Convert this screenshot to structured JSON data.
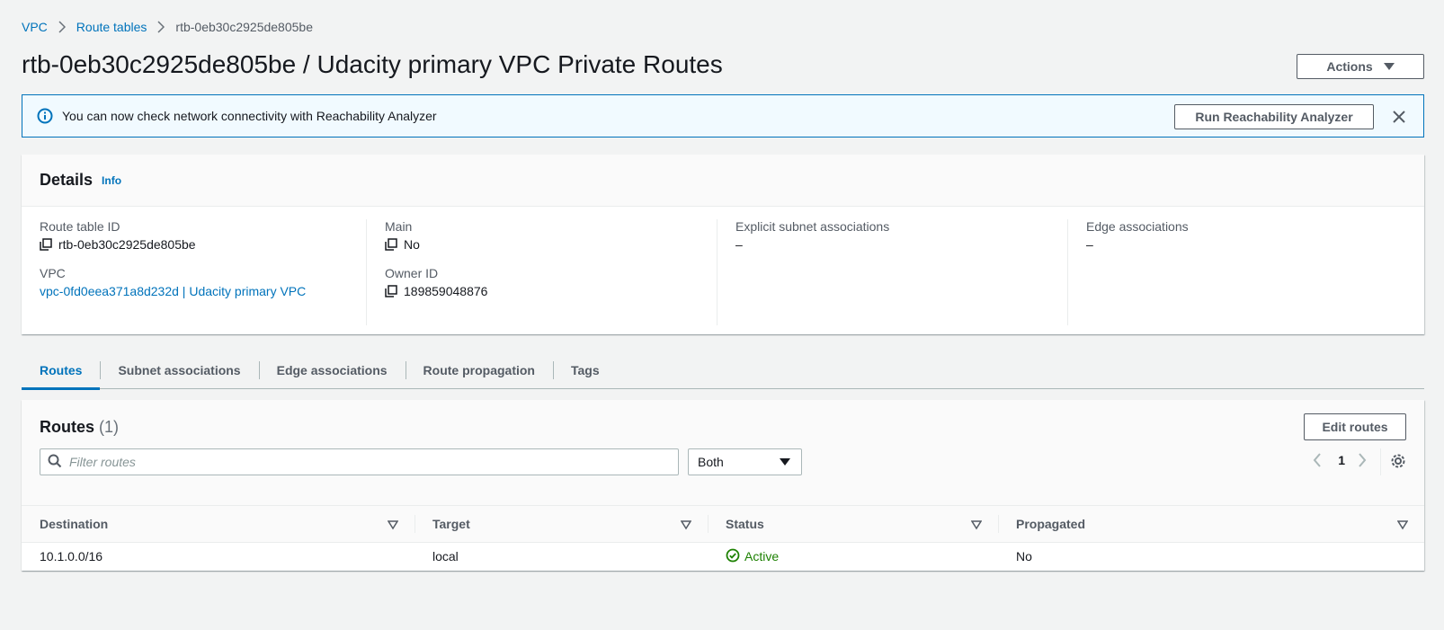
{
  "breadcrumb": {
    "items": [
      "VPC",
      "Route tables"
    ],
    "current": "rtb-0eb30c2925de805be"
  },
  "header": {
    "title": "rtb-0eb30c2925de805be / Udacity primary VPC Private Routes",
    "actions_label": "Actions"
  },
  "flash": {
    "message": "You can now check network connectivity with Reachability Analyzer",
    "button_label": "Run Reachability Analyzer"
  },
  "details": {
    "title": "Details",
    "info_label": "Info",
    "route_table_id": {
      "label": "Route table ID",
      "value": "rtb-0eb30c2925de805be"
    },
    "vpc": {
      "label": "VPC",
      "value": "vpc-0fd0eea371a8d232d | Udacity primary VPC"
    },
    "main": {
      "label": "Main",
      "value": "No"
    },
    "owner_id": {
      "label": "Owner ID",
      "value": "189859048876"
    },
    "explicit_subnet": {
      "label": "Explicit subnet associations",
      "value": "–"
    },
    "edge_assoc": {
      "label": "Edge associations",
      "value": "–"
    }
  },
  "tabs": [
    "Routes",
    "Subnet associations",
    "Edge associations",
    "Route propagation",
    "Tags"
  ],
  "routes": {
    "title": "Routes",
    "count": "(1)",
    "edit_label": "Edit routes",
    "filter_placeholder": "Filter routes",
    "select_value": "Both",
    "page": "1",
    "columns": [
      "Destination",
      "Target",
      "Status",
      "Propagated"
    ],
    "rows": [
      {
        "destination": "10.1.0.0/16",
        "target": "local",
        "status": "Active",
        "propagated": "No"
      }
    ]
  },
  "colors": {
    "link": "#0073bb",
    "success": "#1d8102",
    "text": "#16191f",
    "muted": "#545b64"
  }
}
